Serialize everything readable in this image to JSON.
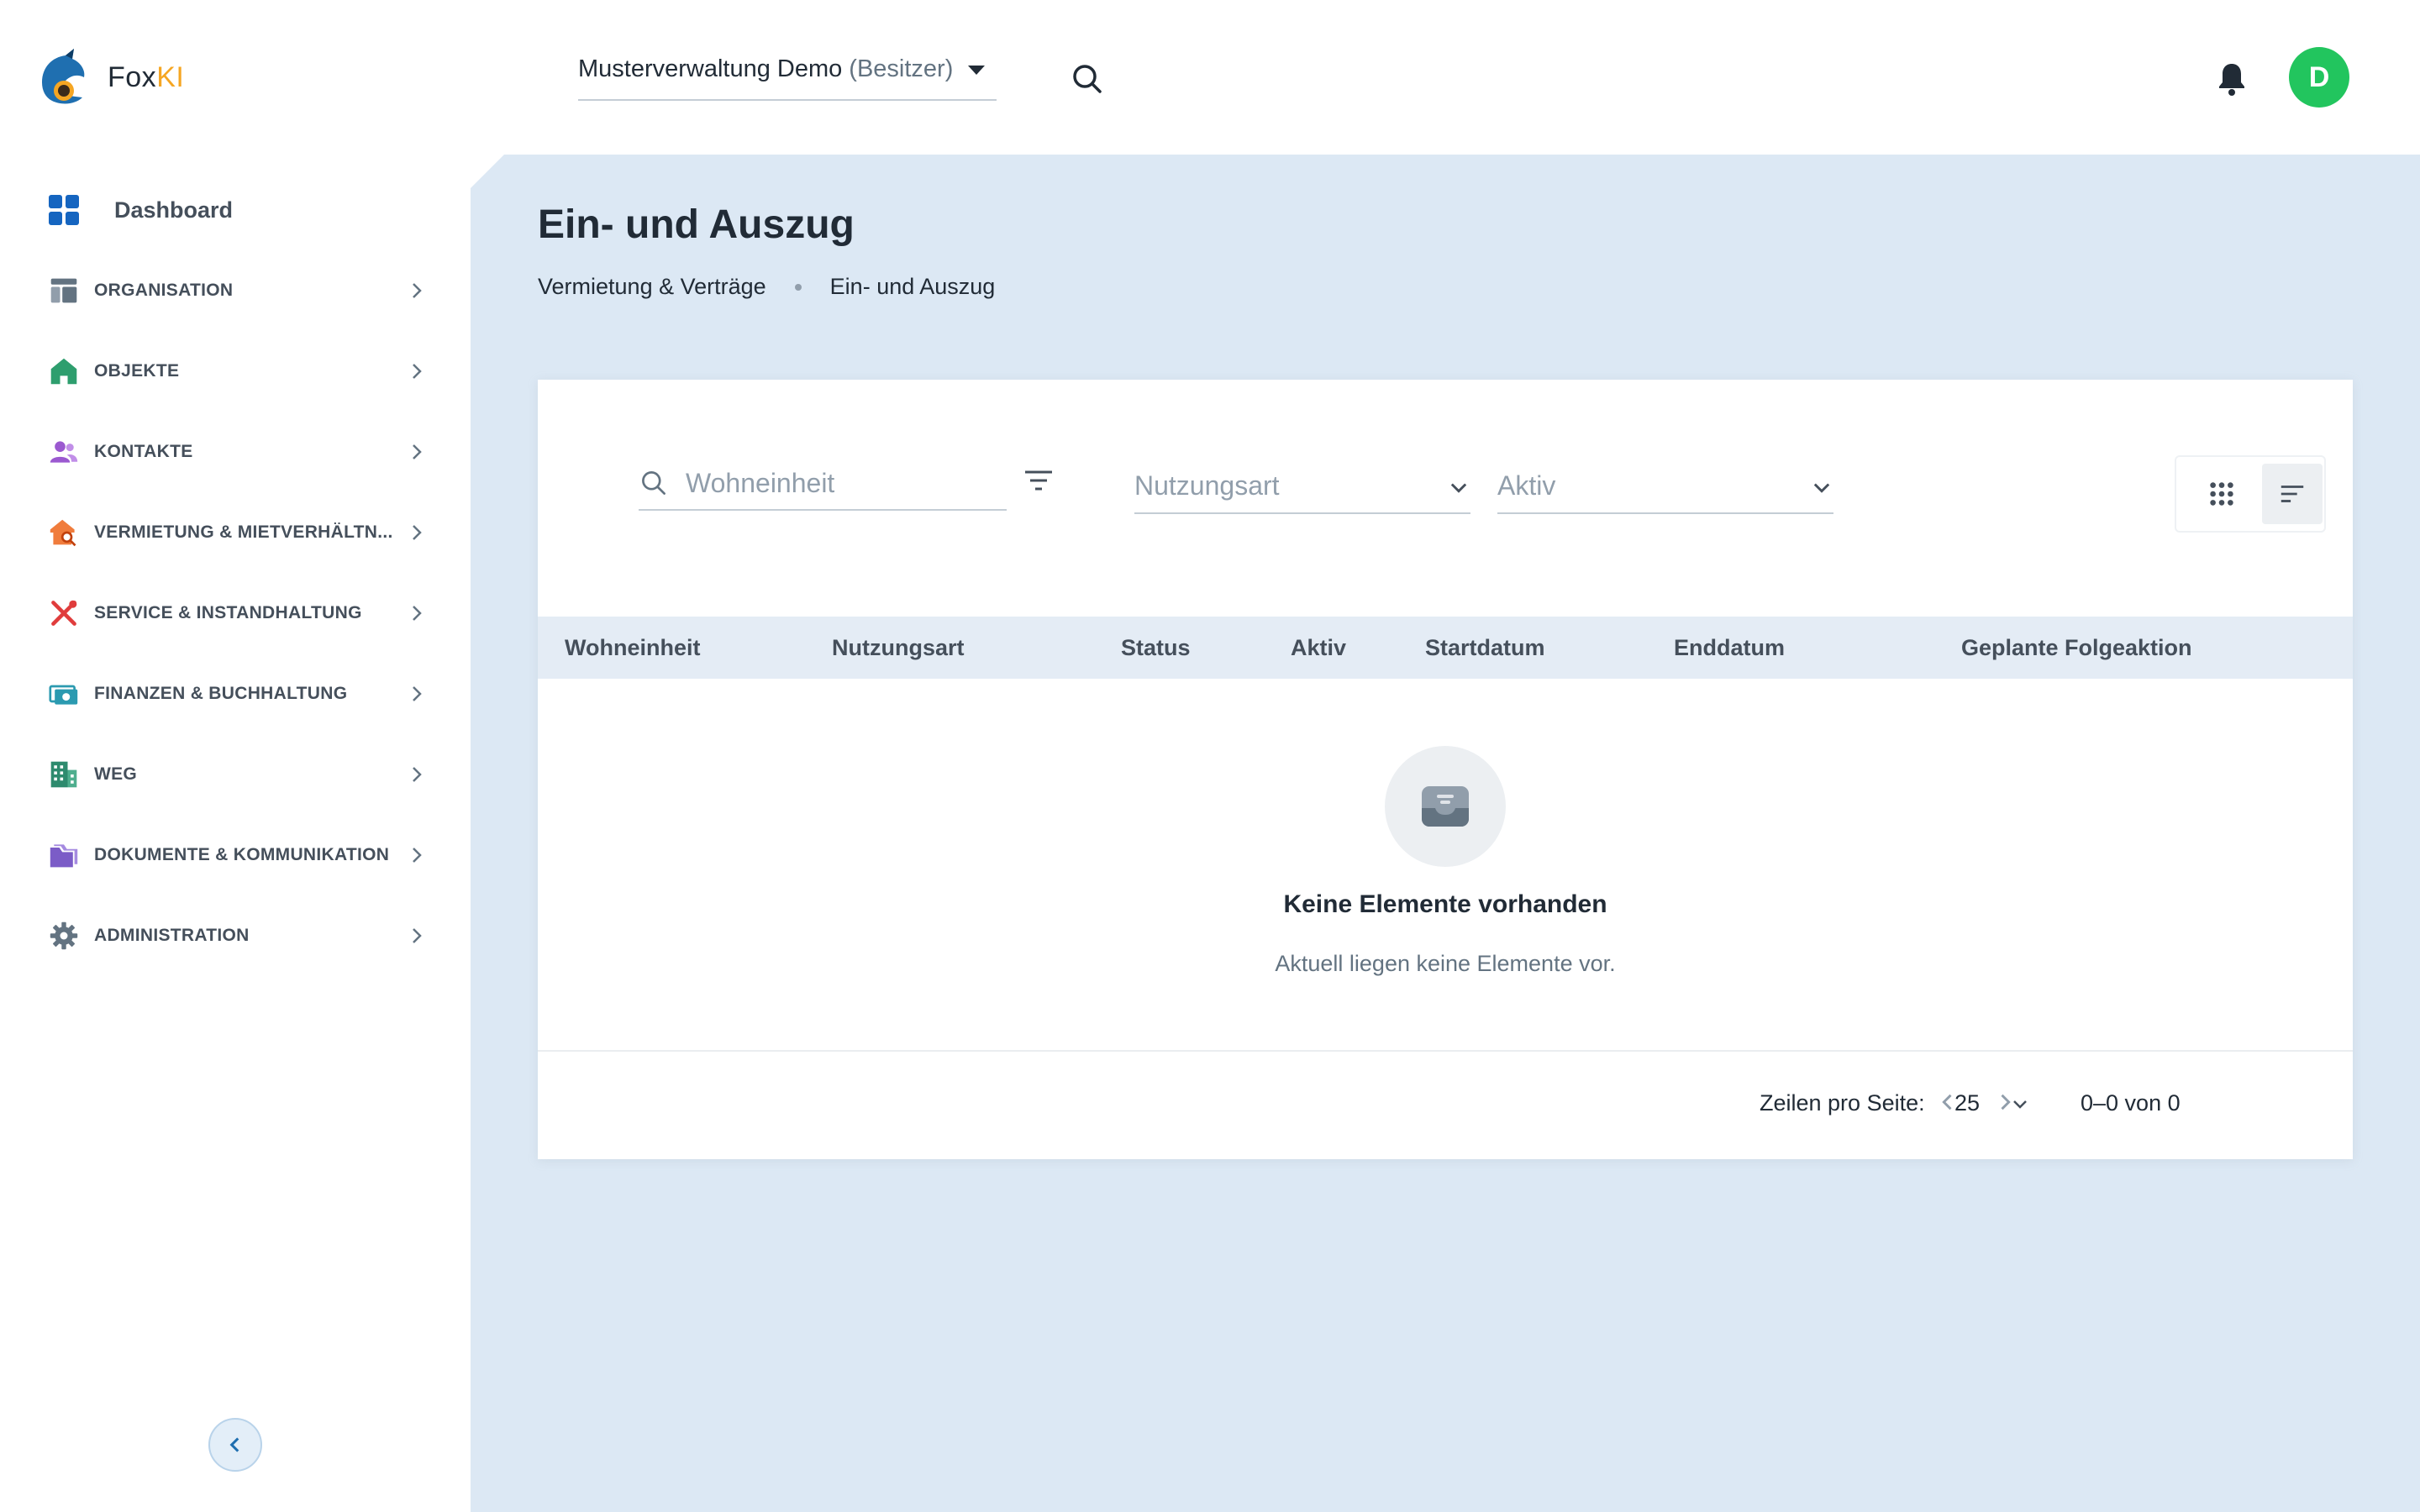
{
  "app": {
    "name_part1": "Fox",
    "name_part2": "KI"
  },
  "header": {
    "org_name": "Musterverwaltung Demo",
    "org_role": "(Besitzer)",
    "avatar_initial": "D"
  },
  "sidebar": {
    "dashboard_label": "Dashboard",
    "items": [
      {
        "label": "ORGANISATION",
        "icon": "organisation-icon"
      },
      {
        "label": "OBJEKTE",
        "icon": "house-icon"
      },
      {
        "label": "KONTAKTE",
        "icon": "contacts-icon"
      },
      {
        "label": "VERMIETUNG & MIETVERHÄLTN...",
        "icon": "rental-search-icon"
      },
      {
        "label": "SERVICE & INSTANDHALTUNG",
        "icon": "tools-icon"
      },
      {
        "label": "FINANZEN & BUCHHALTUNG",
        "icon": "money-icon"
      },
      {
        "label": "WEG",
        "icon": "building-icon"
      },
      {
        "label": "DOKUMENTE & KOMMUNIKATION",
        "icon": "folder-icon"
      },
      {
        "label": "ADMINISTRATION",
        "icon": "gear-icon"
      }
    ]
  },
  "page": {
    "title": "Ein- und Auszug",
    "breadcrumb": [
      "Vermietung & Verträge",
      "Ein- und Auszug"
    ]
  },
  "filters": {
    "search_placeholder": "Wohneinheit",
    "usage_placeholder": "Nutzungsart",
    "active_placeholder": "Aktiv"
  },
  "table": {
    "columns": [
      "Wohneinheit",
      "Nutzungsart",
      "Status",
      "Aktiv",
      "Startdatum",
      "Enddatum",
      "Geplante Folgeaktion"
    ],
    "rows": [],
    "empty_title": "Keine Elemente vorhanden",
    "empty_subtitle": "Aktuell liegen keine Elemente vor."
  },
  "pagination": {
    "rows_per_page_label": "Zeilen pro Seite:",
    "rows_per_page": "25",
    "range": "0–0 von 0"
  },
  "colors": {
    "accent": "#f5a623",
    "avatar": "#22c55e",
    "main_bg": "#dce8f4",
    "dashboard_icon": "#1565c0"
  }
}
